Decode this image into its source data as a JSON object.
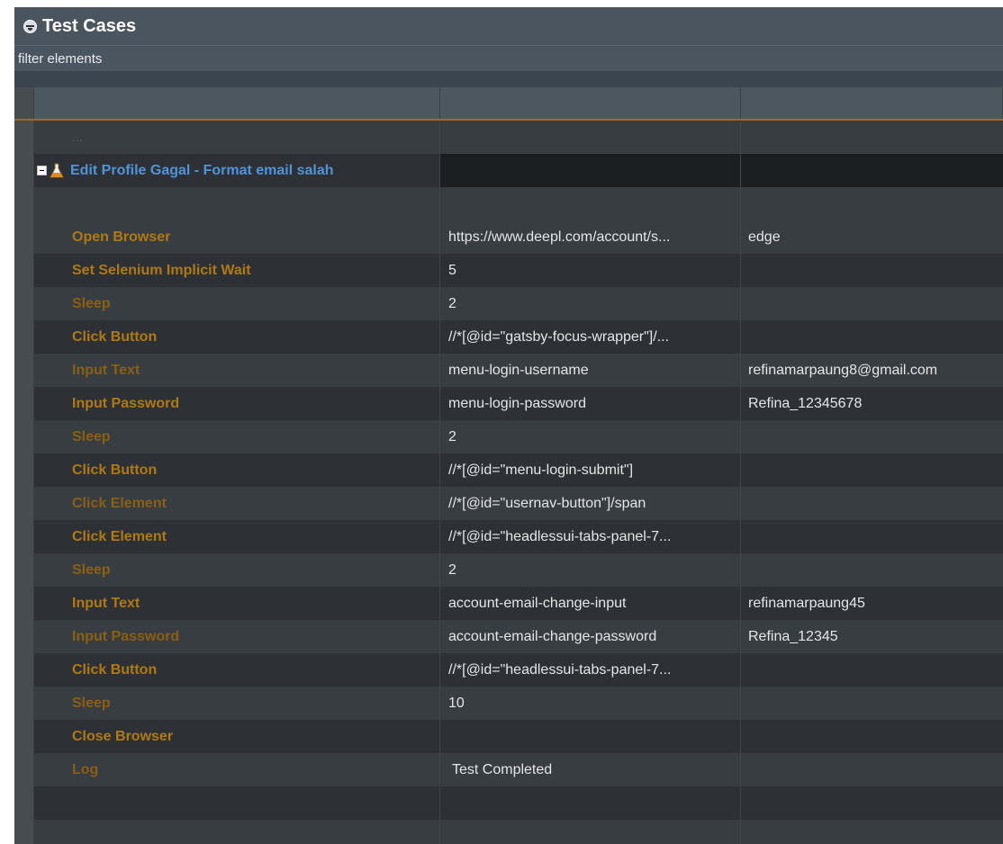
{
  "panel": {
    "title": "Test Cases",
    "filter_placeholder": "filter elements"
  },
  "collapsed_marker": "...",
  "test_case": {
    "name": "Edit Profile Gagal - Format email salah"
  },
  "steps": [
    {
      "keyword": "Open Browser",
      "arg1": "https://www.deepl.com/account/s...",
      "arg2": "edge",
      "dim": false
    },
    {
      "keyword": "Set Selenium Implicit Wait",
      "arg1": "5",
      "arg2": "",
      "dim": false
    },
    {
      "keyword": "Sleep",
      "arg1": "2",
      "arg2": "",
      "dim": true
    },
    {
      "keyword": "Click Button",
      "arg1": "//*[@id=\"gatsby-focus-wrapper\"]/...",
      "arg2": "",
      "dim": false
    },
    {
      "keyword": "Input Text",
      "arg1": "menu-login-username",
      "arg2": "refinamarpaung8@gmail.com",
      "dim": true
    },
    {
      "keyword": "Input Password",
      "arg1": "menu-login-password",
      "arg2": "Refina_12345678",
      "dim": false
    },
    {
      "keyword": "Sleep",
      "arg1": "2",
      "arg2": "",
      "dim": true
    },
    {
      "keyword": "Click Button",
      "arg1": "//*[@id=\"menu-login-submit\"]",
      "arg2": "",
      "dim": false
    },
    {
      "keyword": "Click Element",
      "arg1": "//*[@id=\"usernav-button\"]/span",
      "arg2": "",
      "dim": true
    },
    {
      "keyword": "Click Element",
      "arg1": "//*[@id=\"headlessui-tabs-panel-7...",
      "arg2": "",
      "dim": false
    },
    {
      "keyword": "Sleep",
      "arg1": "2",
      "arg2": "",
      "dim": true
    },
    {
      "keyword": "Input Text",
      "arg1": "account-email-change-input",
      "arg2": "refinamarpaung45",
      "dim": false
    },
    {
      "keyword": "Input Password",
      "arg1": "account-email-change-password",
      "arg2": "Refina_12345",
      "dim": true
    },
    {
      "keyword": "Click Button",
      "arg1": "//*[@id=\"headlessui-tabs-panel-7...",
      "arg2": "",
      "dim": false
    },
    {
      "keyword": "Sleep",
      "arg1": "10",
      "arg2": "",
      "dim": true
    },
    {
      "keyword": "Close Browser",
      "arg1": "",
      "arg2": "",
      "dim": false
    },
    {
      "keyword": "Log",
      "arg1": "Test Completed",
      "arg2": "",
      "dim": true
    }
  ],
  "colors": {
    "keyword": "#b07a10",
    "keyword_dim": "#8a5f12",
    "test_case_name": "#4f94d8",
    "header_border": "#a06a1a"
  },
  "icons": {
    "title": "robot-icon",
    "collapse": "collapse-minus-icon",
    "test_case": "flask-icon"
  }
}
